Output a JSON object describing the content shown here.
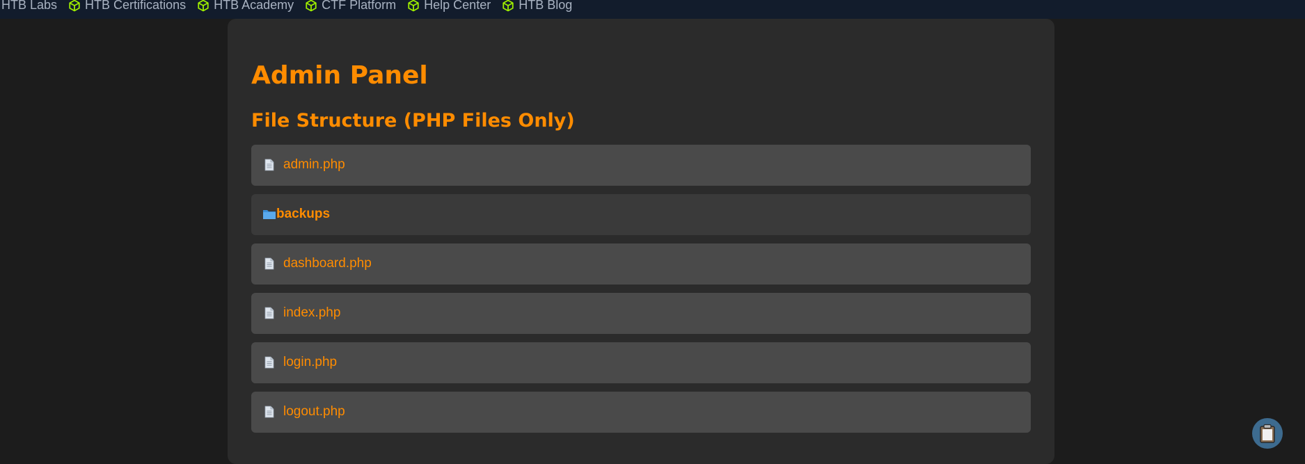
{
  "bookmarks": [
    {
      "label": "HTB Labs",
      "has_icon": false
    },
    {
      "label": "HTB Certifications",
      "has_icon": true
    },
    {
      "label": "HTB Academy",
      "has_icon": true
    },
    {
      "label": "CTF Platform",
      "has_icon": true
    },
    {
      "label": "Help Center",
      "has_icon": true
    },
    {
      "label": "HTB Blog",
      "has_icon": true
    }
  ],
  "page": {
    "title": "Admin Panel",
    "section_title": "File Structure (PHP Files Only)"
  },
  "files": [
    {
      "name": "admin.php",
      "type": "file",
      "icon": "document-icon"
    },
    {
      "name": "backups",
      "type": "folder",
      "icon": "folder-icon"
    },
    {
      "name": "dashboard.php",
      "type": "file",
      "icon": "document-icon"
    },
    {
      "name": "index.php",
      "type": "file",
      "icon": "document-icon"
    },
    {
      "name": "login.php",
      "type": "file",
      "icon": "document-icon"
    },
    {
      "name": "logout.php",
      "type": "file",
      "icon": "document-icon"
    }
  ],
  "floating_button": {
    "icon": "clipboard-icon"
  },
  "colors": {
    "accent": "#ff8c00",
    "bookmark_bar": "#121c2c",
    "panel_bg": "#2b2b2b",
    "page_bg": "#1c1c1c",
    "file_row_bg": "#4a4a4a",
    "folder_row_bg": "#3a3a3a",
    "htb_green": "#9fef00"
  }
}
